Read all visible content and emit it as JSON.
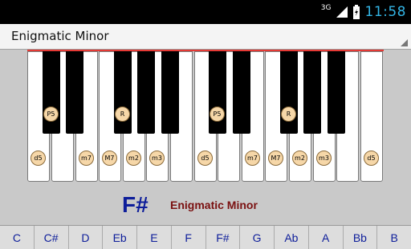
{
  "status": {
    "network": "3G",
    "time": "11:58"
  },
  "scale_selector": {
    "selected": "Enigmatic Minor"
  },
  "display": {
    "root": "F#",
    "scale": "Enigmatic Minor"
  },
  "keyboard_labels": {
    "key1": "d5",
    "key2": "m7",
    "key3": "M7",
    "key4": "m2",
    "key5": "m3",
    "key6": "d5",
    "key7": "m7",
    "key8": "M7",
    "key9": "m2",
    "key10": "m3",
    "key11": "d5",
    "black1": "P5",
    "black2": "R",
    "black3": "P5",
    "black4": "R"
  },
  "notes": [
    "C",
    "C#",
    "D",
    "Eb",
    "E",
    "F",
    "F#",
    "G",
    "Ab",
    "A",
    "Bb",
    "B"
  ],
  "colors": {
    "accent": "#33b5e5",
    "root": "#0d1d9a",
    "scale": "#7a1010",
    "highlight": "#f6d7a8"
  }
}
